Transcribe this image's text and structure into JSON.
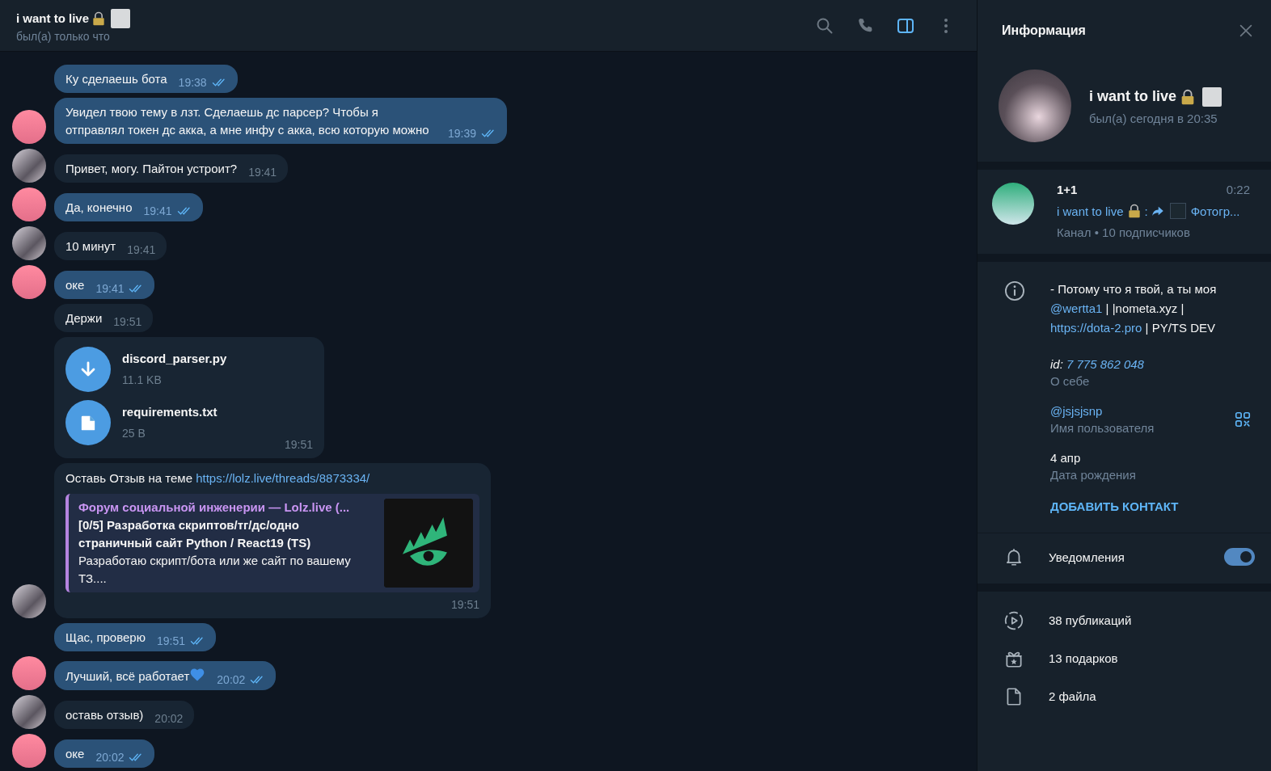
{
  "header": {
    "title": "i want to live",
    "status": "был(а) только что",
    "tools": [
      {
        "kind": "search",
        "active": false
      },
      {
        "kind": "call",
        "active": false
      },
      {
        "kind": "sidebar",
        "active": true
      },
      {
        "kind": "more",
        "active": false
      }
    ]
  },
  "messages": [
    {
      "kind": "text",
      "outgoing": true,
      "show_avatar": false,
      "text": "Ку сделаешь бота",
      "time": "19:38",
      "read": true
    },
    {
      "kind": "text",
      "outgoing": true,
      "show_avatar": true,
      "text": "Увидел твою тему в лзт. Сделаешь дс парсер? Чтобы я отправлял токен дс акка, а мне инфу с акка, всю которую можно",
      "time": "19:39",
      "read": true
    },
    {
      "kind": "text",
      "outgoing": false,
      "show_avatar": true,
      "text": "Привет, могу. Пайтон устроит?",
      "time": "19:41"
    },
    {
      "kind": "text",
      "outgoing": true,
      "show_avatar": true,
      "text": "Да, конечно",
      "time": "19:41",
      "read": true
    },
    {
      "kind": "text",
      "outgoing": false,
      "show_avatar": true,
      "text": "10 минут",
      "time": "19:41"
    },
    {
      "kind": "text",
      "outgoing": true,
      "show_avatar": true,
      "text": "оке",
      "time": "19:41",
      "read": true
    },
    {
      "kind": "text",
      "outgoing": false,
      "show_avatar": false,
      "text": "Держи",
      "time": "19:51"
    },
    {
      "kind": "files",
      "outgoing": false,
      "show_avatar": false,
      "time": "19:51",
      "files": [
        {
          "kind": "download",
          "name": "discord_parser.py",
          "size": "11.1 KB"
        },
        {
          "kind": "document",
          "name": "requirements.txt",
          "size": "25 B"
        }
      ]
    },
    {
      "kind": "link",
      "outgoing": false,
      "show_avatar": true,
      "text": "Оставь Отзыв на теме",
      "link": "https://lolz.live/threads/8873334/",
      "time": "19:51",
      "preview": {
        "site": "Форум социальной инженерии —  Lolz.live (...",
        "title": "[0/5] Разработка скриптов/тг/дс/одно страничный сайт Python / React19 (TS)",
        "description": "Разработаю скрипт/бота или же сайт по вашему ТЗ...."
      }
    },
    {
      "kind": "text",
      "outgoing": true,
      "show_avatar": false,
      "text": "Щас, проверю",
      "time": "19:51",
      "read": true
    },
    {
      "kind": "text",
      "outgoing": true,
      "show_avatar": true,
      "text": "Лучший, всё работает",
      "heart": true,
      "time": "20:02",
      "read": true
    },
    {
      "kind": "text",
      "outgoing": false,
      "show_avatar": true,
      "text": "оставь отзыв)",
      "time": "20:02"
    },
    {
      "kind": "text",
      "outgoing": true,
      "show_avatar": true,
      "text": "оке",
      "time": "20:02",
      "read": true
    }
  ],
  "info": {
    "title": "Информация",
    "profile": {
      "name": "i want to live",
      "status": "был(а) сегодня в 20:35"
    },
    "channel": {
      "name": "1+1",
      "time": "0:22",
      "sender": "i want to live",
      "separator": ":",
      "media_label": "Фотогр...",
      "meta": "Канал • 10 подписчиков"
    },
    "bio": {
      "segments": [
        {
          "kind": "text",
          "text": "- Потому что я твой, а ты моя "
        },
        {
          "kind": "link",
          "text": "@wertta1"
        },
        {
          "kind": "text",
          "text": " | |nometa.xyz | "
        },
        {
          "kind": "link",
          "text": "https://dota-2.pro"
        },
        {
          "kind": "text",
          "text": " | PY/TS DEV"
        }
      ],
      "id_label": "id:",
      "id_value": "7 775 862 048",
      "caption": "О себе"
    },
    "username": {
      "value": "@jsjsjsnp",
      "caption": "Имя пользователя"
    },
    "birthday": {
      "value": "4 апр",
      "caption": "Дата рождения"
    },
    "add_contact": "ДОБАВИТЬ КОНТАКТ",
    "notifications": {
      "label": "Уведомления",
      "on": true
    },
    "stats": [
      {
        "kind": "posts",
        "label": "38 публикаций"
      },
      {
        "kind": "gifts",
        "label": "13 подарков"
      },
      {
        "kind": "files",
        "label": "2 файла"
      }
    ]
  }
}
